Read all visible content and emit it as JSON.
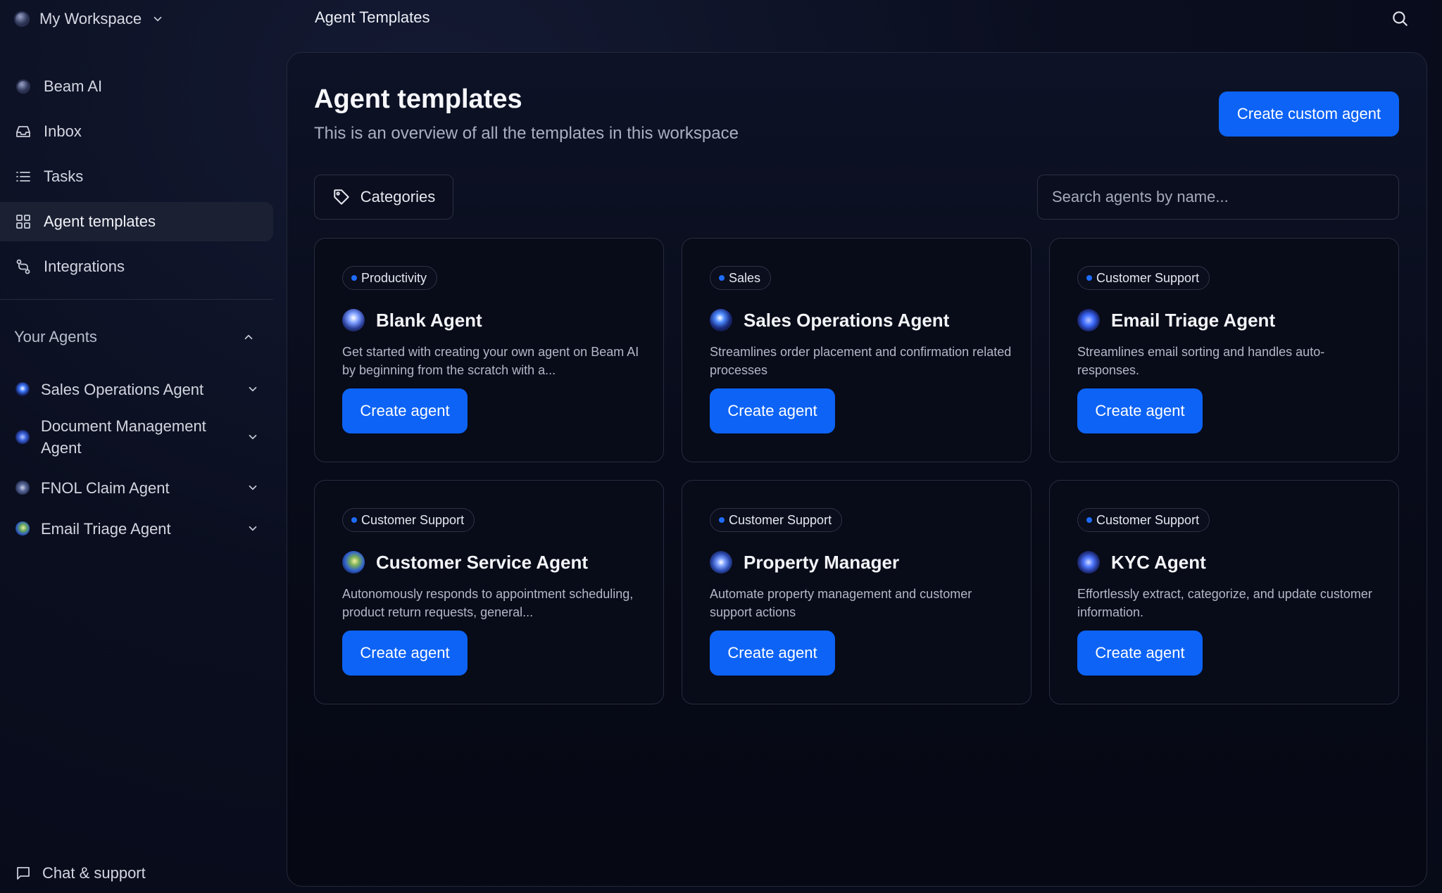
{
  "workspace": {
    "name": "My Workspace"
  },
  "header": {
    "title": "Agent Templates"
  },
  "nav": [
    {
      "label": "Beam AI",
      "icon": "beam-logo-icon"
    },
    {
      "label": "Inbox",
      "icon": "inbox-icon"
    },
    {
      "label": "Tasks",
      "icon": "list-icon"
    },
    {
      "label": "Agent templates",
      "icon": "grid-icon",
      "active": true
    },
    {
      "label": "Integrations",
      "icon": "integrations-icon"
    }
  ],
  "your_agents": {
    "title": "Your Agents",
    "items": [
      {
        "label": "Sales Operations Agent"
      },
      {
        "label": "Document Management Agent"
      },
      {
        "label": "FNOL Claim Agent"
      },
      {
        "label": "Email Triage Agent"
      }
    ]
  },
  "footer": {
    "chat_label": "Chat & support"
  },
  "main": {
    "title": "Agent templates",
    "subtitle": "This is an overview of all the templates in this workspace",
    "create_custom_label": "Create custom agent",
    "categories_label": "Categories",
    "search_placeholder": "Search agents by name..."
  },
  "templates": [
    {
      "category": "Productivity",
      "title": "Blank Agent",
      "description": "Get started with creating your own agent on Beam AI by beginning from the scratch with a...",
      "button": "Create agent"
    },
    {
      "category": "Sales",
      "title": "Sales Operations Agent",
      "description": "Streamlines order placement and confirmation related processes",
      "button": "Create agent"
    },
    {
      "category": "Customer Support",
      "title": "Email Triage Agent",
      "description": "Streamlines email sorting and handles auto-responses.",
      "button": "Create agent"
    },
    {
      "category": "Customer Support",
      "title": "Customer Service Agent",
      "description": "Autonomously responds to appointment scheduling, product return requests, general...",
      "button": "Create agent"
    },
    {
      "category": "Customer Support",
      "title": "Property Manager",
      "description": "Automate property management and customer support actions",
      "button": "Create agent"
    },
    {
      "category": "Customer Support",
      "title": "KYC Agent",
      "description": "Effortlessly extract, categorize, and update customer information.",
      "button": "Create agent"
    }
  ],
  "colors": {
    "accent": "#0d63f5",
    "badge_dot": "#1e6cff",
    "background": "#080b1a"
  }
}
